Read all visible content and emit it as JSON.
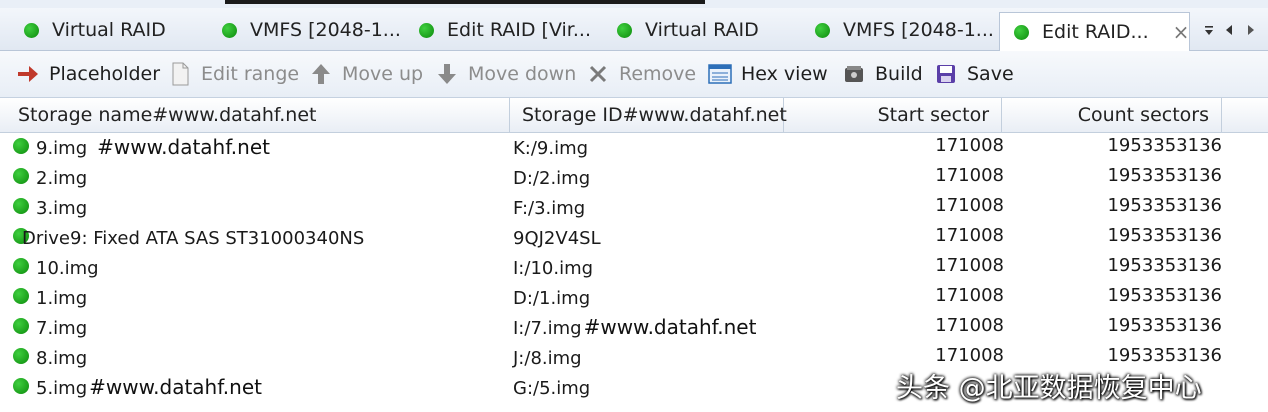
{
  "tabs": [
    {
      "label": "Virtual RAID",
      "active": false
    },
    {
      "label": "VMFS [2048-1...",
      "active": false
    },
    {
      "label": "Edit RAID [Vir...",
      "active": false
    },
    {
      "label": "Virtual RAID",
      "active": false
    },
    {
      "label": "VMFS [2048-1...",
      "active": false
    },
    {
      "label": "Edit RAID...",
      "active": true
    }
  ],
  "tab_close_glyph": "×",
  "toolbar": {
    "placeholder": "Placeholder",
    "edit_range": "Edit range",
    "move_up": "Move up",
    "move_down": "Move down",
    "remove": "Remove",
    "hex_view": "Hex view",
    "build": "Build",
    "save": "Save"
  },
  "columns": {
    "name": "Storage name#www.datahf.net",
    "id": "Storage ID#www.datahf.net",
    "start": "Start sector",
    "count": "Count sectors"
  },
  "rows": [
    {
      "name": "9.img",
      "name_note": "#www.datahf.net",
      "id": "K:/9.img",
      "id_note": "",
      "start": "171008",
      "count": "1953353136"
    },
    {
      "name": "2.img",
      "name_note": "",
      "id": "D:/2.img",
      "id_note": "",
      "start": "171008",
      "count": "1953353136"
    },
    {
      "name": "3.img",
      "name_note": "",
      "id": "F:/3.img",
      "id_note": "",
      "start": "171008",
      "count": "1953353136"
    },
    {
      "name": "Drive9: Fixed ATA SAS ST31000340NS",
      "name_note": "",
      "id": "9QJ2V4SL",
      "id_note": "",
      "start": "171008",
      "count": "1953353136"
    },
    {
      "name": "10.img",
      "name_note": "",
      "id": "I:/10.img",
      "id_note": "",
      "start": "171008",
      "count": "1953353136"
    },
    {
      "name": "1.img",
      "name_note": "",
      "id": "D:/1.img",
      "id_note": "",
      "start": "171008",
      "count": "1953353136"
    },
    {
      "name": "7.img",
      "name_note": "",
      "id": "I:/7.img",
      "id_note": "#www.datahf.net",
      "start": "171008",
      "count": "1953353136"
    },
    {
      "name": "8.img",
      "name_note": "",
      "id": "J:/8.img",
      "id_note": "",
      "start": "171008",
      "count": "1953353136"
    },
    {
      "name": "5.img",
      "name_note": "#www.datahf.net",
      "id": "G:/5.img",
      "id_note": "",
      "start": "",
      "count": ""
    }
  ],
  "watermark": "头条 @北亚数据恢复中心",
  "colors": {
    "status_green": "#1aa51a",
    "accent_blue": "#2d6fb8"
  }
}
